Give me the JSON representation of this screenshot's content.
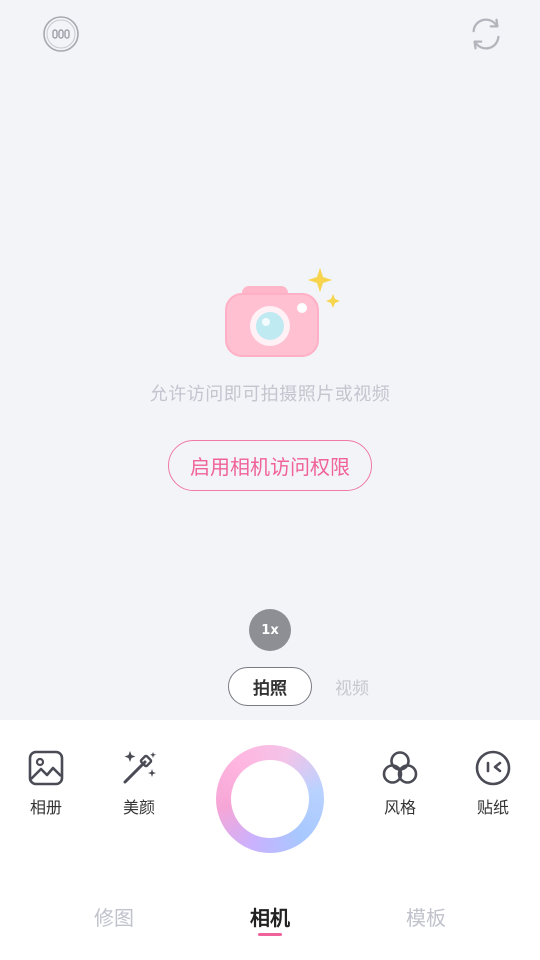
{
  "hint_text": "允许访问即可拍摄照片或视频",
  "permission_button": "启用相机访问权限",
  "zoom_label": "1x",
  "modes": {
    "photo": "拍照",
    "video": "视频"
  },
  "tools": {
    "album": "相册",
    "beauty": "美颜",
    "style": "风格",
    "sticker": "贴纸"
  },
  "tabs": {
    "edit": "修图",
    "camera": "相机",
    "template": "模板"
  },
  "colors": {
    "accent": "#f0629a",
    "background": "#f3f4f8"
  }
}
